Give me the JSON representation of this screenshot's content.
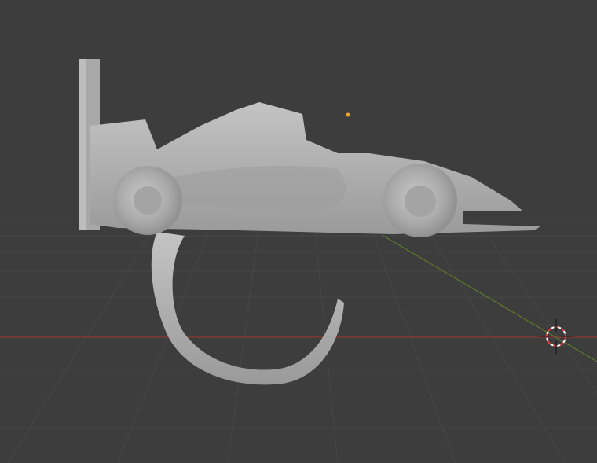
{
  "viewport": {
    "background_color": "#3d3d3d",
    "grid_color": "#4a4a4a",
    "x_axis_color": "#8a3a3a",
    "y_axis_color": "#5e7a2a",
    "origin_color": "#f0a030",
    "model_color": "#b4b4b4",
    "cursor_icon": "3d-cursor-icon",
    "origin_icon": "object-origin-icon"
  }
}
